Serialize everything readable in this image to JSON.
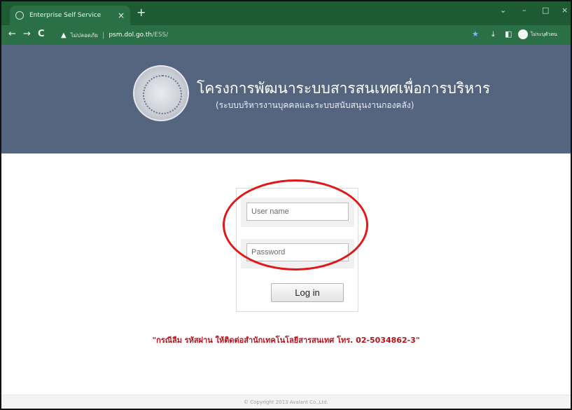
{
  "browser": {
    "tab_title": "Enterprise Self Service",
    "tab_close": "×",
    "new_tab": "+",
    "window_controls": {
      "dropdown": "⌄",
      "minimize": "–",
      "maximize": "□",
      "close": "×"
    },
    "nav": {
      "back": "←",
      "forward": "→",
      "reload": "C"
    },
    "address": {
      "warning_icon": "▲",
      "insecure_label": "ไม่ปลอดภัย",
      "separator": "|",
      "host": "psm.dol.go.th",
      "path": "/ESS/"
    },
    "toolbar_icons": {
      "bookmark": "★",
      "download": "⤓",
      "sidepanel": "◧"
    },
    "profile_label": "ไม่ระบุตัวตน"
  },
  "header": {
    "title": "โครงการพัฒนาระบบสารสนเทศเพื่อการบริหาร",
    "subtitle": "(ระบบบริหารงานบุคคลและระบบสนับสนุนงานกองคลัง)"
  },
  "login": {
    "username_placeholder": "User name",
    "password_placeholder": "Password",
    "button_label": "Log in"
  },
  "notice": "\"กรณีลืม รหัสผ่าน ให้ติดต่อสำนักเทคโนโลยีสารสนเทศ โทร. 02-5034862-3\"",
  "footer": "© Copyright 2013 Avalant Co.,Ltd.",
  "colors": {
    "browser_chrome": "#1e5b35",
    "banner": "#56657f",
    "highlight": "#e01818",
    "notice": "#b5121b"
  }
}
